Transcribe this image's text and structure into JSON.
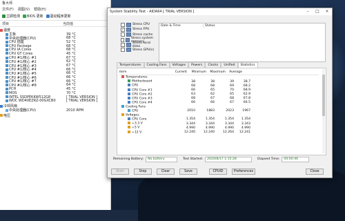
{
  "colors": {
    "accent": "#1a73c9",
    "desktop": "#1d3354",
    "panel": "#ffffff"
  },
  "left_window": {
    "title": "鲁大师",
    "menu": [
      "文件(F)",
      "视图(V)",
      "帮助(H)"
    ],
    "toolbar": [
      {
        "label": "立即检测",
        "icon": "refresh-icon"
      },
      {
        "label": "BIOS 更新",
        "icon": "download-icon"
      },
      {
        "label": "驱动程序更新",
        "icon": "search-icon"
      }
    ],
    "columns": [
      "项目",
      "当前值"
    ],
    "sections": [
      {
        "title": "温度",
        "rows": [
          {
            "name": "主板",
            "value": "39 °C"
          },
          {
            "name": "中央处理器(CPU)",
            "value": "68 °C"
          },
          {
            "name": "CPU 插座",
            "value": "52 °C"
          },
          {
            "name": "CPU Package",
            "value": "68 °C"
          },
          {
            "name": "CPU IA Cores",
            "value": "68 °C"
          },
          {
            "name": "CPU GT Cores",
            "value": "45 °C"
          },
          {
            "name": "CPU #1/核心 #1",
            "value": "67 °C"
          },
          {
            "name": "CPU #1/核心 #2",
            "value": "62 °C"
          },
          {
            "name": "CPU #1/核心 #3",
            "value": "67 °C"
          },
          {
            "name": "CPU #1/核心 #4",
            "value": "66 °C"
          },
          {
            "name": "CPU #1/核心 #5",
            "value": "66 °C"
          },
          {
            "name": "CPU #1/核心 #6",
            "value": "66 °C"
          },
          {
            "name": "CPU #1/核心 #7",
            "value": "66 °C"
          },
          {
            "name": "CPU #1/核心 #8",
            "value": "64 °C"
          },
          {
            "name": "PCH",
            "value": "45 °C"
          },
          {
            "name": "MOS",
            "value": "70 °C"
          },
          {
            "name": "INTEL SSDPEKKW512G8",
            "value": "[ TRIAL VERSION ]"
          },
          {
            "name": "WDC WD40EZRZ-00GXCB0",
            "value": "[ TRIAL VERSION ]"
          }
        ]
      },
      {
        "title": "冷却风扇",
        "rows": [
          {
            "name": "中央处理器(CPU)",
            "value": "2010 RPM"
          }
        ]
      },
      {
        "title": "电压",
        "rows": []
      }
    ]
  },
  "stability": {
    "title": "System Stability Test - AIDA64 [ TRIAL VERSION ]",
    "controls": [
      "–",
      "□",
      "×"
    ],
    "stress": [
      {
        "label": "Stress CPU",
        "checked": false
      },
      {
        "label": "Stress FPU",
        "checked": true
      },
      {
        "label": "Stress cache",
        "checked": false
      },
      {
        "label": "Stress system memory",
        "checked": false
      },
      {
        "label": "Stress local disks",
        "checked": false
      },
      {
        "label": "Stress GPU(s)",
        "checked": false
      }
    ],
    "log_headers": [
      "Date & Time",
      "Status"
    ],
    "tabs": [
      "Temperatures",
      "Cooling Fans",
      "Voltages",
      "Powers",
      "Clocks",
      "Unified",
      "Statistics"
    ],
    "active_tab": "Statistics",
    "grid_headers": [
      "Item",
      "Current",
      "Minimum",
      "Maximum",
      "Average"
    ],
    "grid": [
      {
        "level": 0,
        "name": "Temperatures",
        "icon": "thermometer-icon",
        "vals": [
          "",
          "",
          "",
          ""
        ]
      },
      {
        "level": 1,
        "name": "Motherboard",
        "icon": "motherboard-icon",
        "vals": [
          "38",
          "38",
          "39",
          "38.7"
        ]
      },
      {
        "level": 1,
        "name": "CPU",
        "icon": "cpu-icon",
        "vals": [
          "68",
          "68",
          "69",
          "68.2"
        ]
      },
      {
        "level": 1,
        "name": "CPU Core #1",
        "icon": "cpu-icon",
        "vals": [
          "66",
          "65",
          "70",
          "68.9"
        ]
      },
      {
        "level": 1,
        "name": "CPU Core #2",
        "icon": "cpu-icon",
        "vals": [
          "63",
          "62",
          "65",
          "62.9"
        ]
      },
      {
        "level": 1,
        "name": "CPU Core #3",
        "icon": "cpu-icon",
        "vals": [
          "68",
          "67",
          "68",
          "67.8"
        ]
      },
      {
        "level": 1,
        "name": "CPU Core #4",
        "icon": "cpu-icon",
        "vals": [
          "66",
          "66",
          "67",
          "66.5"
        ]
      },
      {
        "level": 0,
        "name": "Cooling Fans",
        "icon": "fan-icon",
        "vals": [
          "",
          "",
          "",
          ""
        ]
      },
      {
        "level": 1,
        "name": "CPU",
        "icon": "fan-icon",
        "vals": [
          "2010",
          "1883",
          "2023",
          "1967"
        ]
      },
      {
        "level": 0,
        "name": "Voltages",
        "icon": "voltage-icon",
        "vals": [
          "",
          "",
          "",
          ""
        ]
      },
      {
        "level": 1,
        "name": "CPU Core",
        "icon": "cpu-icon",
        "vals": [
          "1.354",
          "1.354",
          "1.354",
          "1.354"
        ]
      },
      {
        "level": 1,
        "name": "+3.3 V",
        "icon": "voltage-icon",
        "vals": [
          "3.344",
          "3.344",
          "3.344",
          "3.343"
        ]
      },
      {
        "level": 1,
        "name": "+5 V",
        "icon": "voltage-icon",
        "vals": [
          "4.990",
          "4.990",
          "4.990",
          "4.990"
        ]
      },
      {
        "level": 1,
        "name": "+12 V",
        "icon": "voltage-icon",
        "vals": [
          "12.240",
          "12.240",
          "12.264",
          "12.241"
        ]
      }
    ],
    "status": {
      "battery_label": "Remaining Battery:",
      "battery_value": "No battery",
      "started_label": "Test Started:",
      "started_value": "2020/8/17 1:15:28",
      "elapsed_label": "Elapsed Time:",
      "elapsed_value": "00:00:46"
    },
    "buttons": [
      "Start",
      "Stop",
      "Clear",
      "Save",
      "CPUID",
      "Preferences",
      "Close"
    ]
  }
}
